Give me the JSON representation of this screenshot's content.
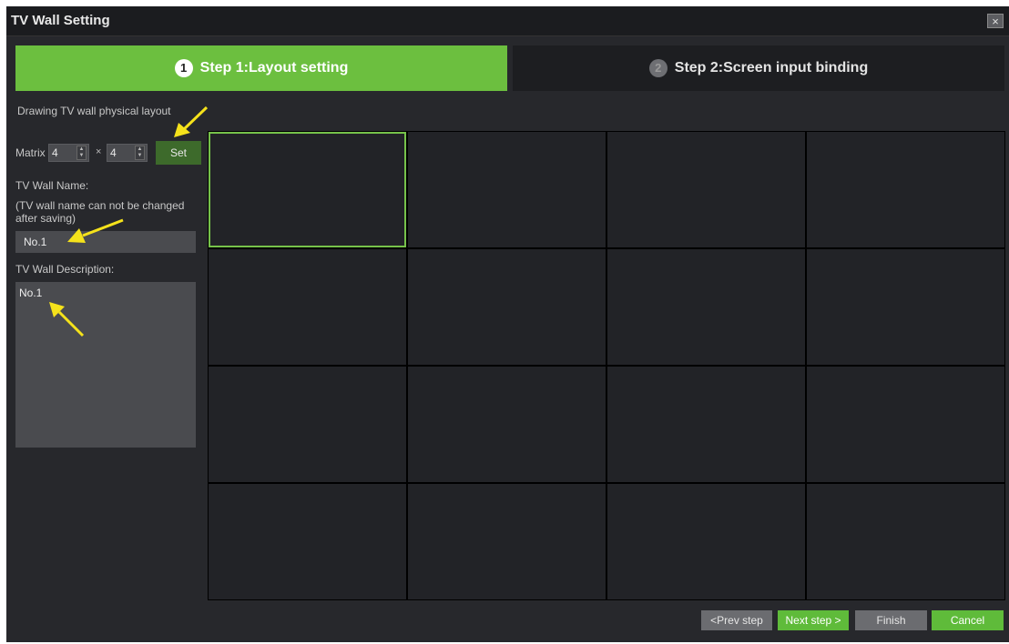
{
  "window": {
    "title": "TV Wall Setting",
    "close_glyph": "×"
  },
  "tabs": [
    {
      "number": "1",
      "label": "Step 1:Layout setting",
      "active": true
    },
    {
      "number": "2",
      "label": "Step 2:Screen input binding",
      "active": false
    }
  ],
  "left_panel": {
    "heading": "Drawing TV wall physical layout",
    "matrix_label": "Matrix",
    "rows_value": "4",
    "cols_value": "4",
    "times_glyph": "×",
    "set_label": "Set",
    "name_label": "TV Wall Name:",
    "name_note": "(TV wall name can not be changed after saving)",
    "name_value": "No.1",
    "description_label": "TV Wall Description:",
    "description_value": "No.1"
  },
  "grid": {
    "rows": 4,
    "cols": 4,
    "selected_cell": 0
  },
  "footer": {
    "prev_label": "<Prev step",
    "next_label": "Next step >",
    "finish_label": "Finish",
    "cancel_label": "Cancel"
  },
  "colors": {
    "accent_green": "#6cbf3f",
    "annotation_arrow": "#f5e21b",
    "background": "#27282c"
  },
  "icons": {
    "close": "close-icon",
    "spinner": "spinner-arrows-icon",
    "annotation": "arrow-pointer-icon"
  }
}
